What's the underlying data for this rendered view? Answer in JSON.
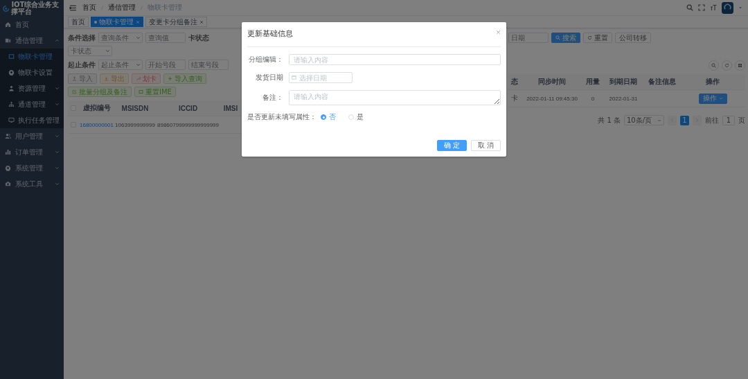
{
  "sidebar": {
    "title": "IOT综合业务支撑平台",
    "items": [
      {
        "label": "首页",
        "selected": false
      },
      {
        "label": "通信管理",
        "selected": false,
        "expanded": true,
        "children": [
          {
            "label": "物联卡管理",
            "selected": true
          },
          {
            "label": "物联卡设置",
            "selected": false
          },
          {
            "label": "资源管理",
            "selected": false,
            "expanded": false
          },
          {
            "label": "通道管理",
            "selected": false,
            "expanded": false
          },
          {
            "label": "执行任务管理",
            "selected": false
          }
        ]
      },
      {
        "label": "用户管理",
        "selected": false,
        "expanded": false
      },
      {
        "label": "订单管理",
        "selected": false,
        "expanded": false
      },
      {
        "label": "系统管理",
        "selected": false,
        "expanded": false
      },
      {
        "label": "系统工具",
        "selected": false,
        "expanded": false
      }
    ]
  },
  "header": {
    "breadcrumb": [
      "首页",
      "通信管理",
      "物联卡管理"
    ]
  },
  "tags": [
    {
      "label": "首页",
      "selected": false,
      "closable": false
    },
    {
      "label": "物联卡管理",
      "selected": true,
      "closable": true
    },
    {
      "label": "变更卡分组备注",
      "selected": false,
      "closable": true
    }
  ],
  "search_form": {
    "left_rows": [
      [
        {
          "kind": "label",
          "text": "条件选择"
        },
        {
          "kind": "select",
          "placeholder": "查询条件"
        },
        {
          "kind": "input",
          "placeholder": "查询值"
        },
        {
          "kind": "label",
          "text": "卡状态"
        },
        {
          "kind": "select",
          "placeholder": "卡状态"
        }
      ],
      [
        {
          "kind": "label",
          "text": "起止条件"
        },
        {
          "kind": "select",
          "placeholder": "起止条件"
        },
        {
          "kind": "input",
          "placeholder": "开始号段"
        },
        {
          "kind": "input",
          "placeholder": "结束号段"
        }
      ]
    ],
    "right": [
      {
        "kind": "input",
        "placeholder": "日期"
      },
      {
        "kind": "primary",
        "text": "搜索"
      },
      {
        "kind": "button",
        "text": "重置"
      },
      {
        "kind": "button",
        "text": "公司转移"
      }
    ]
  },
  "toolbar": [
    {
      "label": "导入",
      "kind": "info"
    },
    {
      "label": "导出",
      "kind": "warning"
    },
    {
      "label": "划卡",
      "kind": "danger"
    },
    {
      "label": "导入查询",
      "kind": "success"
    },
    {
      "label": "批量分组及备注",
      "kind": "success"
    },
    {
      "label": "重置IME",
      "kind": "success"
    }
  ],
  "table_left": {
    "all_checked": false,
    "columns": [
      "虚拟编号",
      "MSISDN",
      "ICCID",
      "IMSI"
    ],
    "rows": [
      {
        "checked": false,
        "cells": [
          "16800000001",
          "1063999999999",
          "89860799999999999999"
        ]
      }
    ]
  },
  "table_right": {
    "columns": [
      "态",
      "同步时间",
      "用量",
      "到期日期",
      "备注信息",
      "操作"
    ],
    "rows": [
      {
        "cells": [
          "卡",
          "2022-01-11 09:45:30",
          "0",
          "2022-01-31"
        ],
        "action": "操作"
      }
    ]
  },
  "pagination": {
    "total": "共 1 条",
    "page_size": "10条/页",
    "pages": [
      {
        "label": "1",
        "selected": true
      }
    ],
    "goto_label": "前往",
    "goto_value": "1",
    "page_unit": "页"
  },
  "modal": {
    "title": "更新基础信息",
    "fields": [
      {
        "kind": "input",
        "label": "分组编辑：",
        "placeholder": "请输入内容"
      },
      {
        "kind": "date",
        "label": "发货日期",
        "placeholder": "选择日期"
      },
      {
        "kind": "textarea",
        "label": "备注：",
        "placeholder": "请输入内容"
      },
      {
        "kind": "radio",
        "label": "是否更新未填写属性：",
        "options": [
          {
            "label": "否",
            "selected": true
          },
          {
            "label": "是",
            "selected": false
          }
        ]
      }
    ],
    "buttons": [
      {
        "label": "确 定",
        "kind": "primary"
      },
      {
        "label": "取 消",
        "kind": "default"
      }
    ]
  }
}
